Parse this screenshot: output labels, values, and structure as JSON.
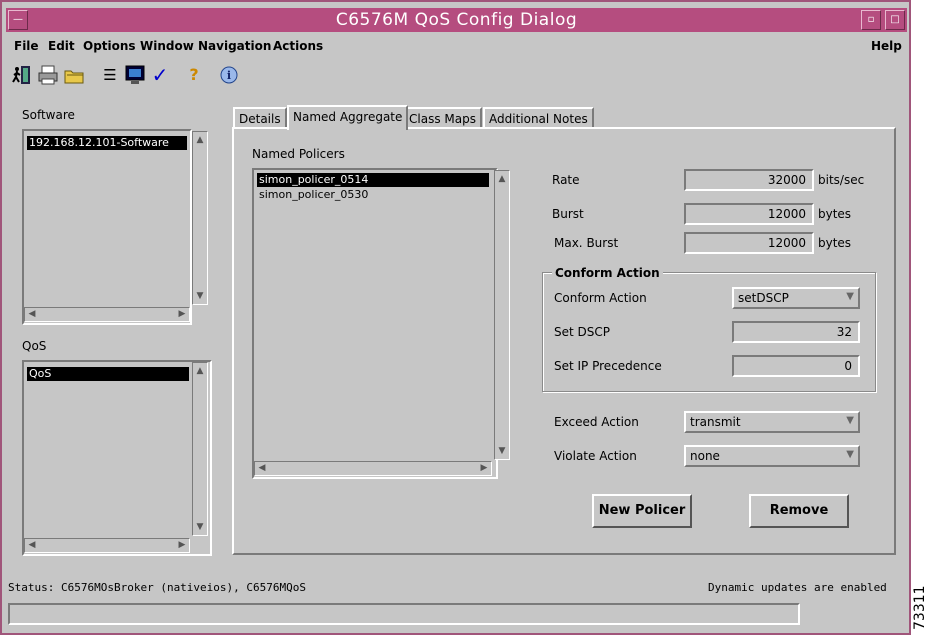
{
  "window": {
    "title": "C6576M QoS Config Dialog",
    "title_color": "#b54d7f",
    "window_menu_glyph": "—",
    "minimize_glyph": "▫",
    "maximize_glyph": "□"
  },
  "menubar": {
    "items": [
      {
        "label": "File"
      },
      {
        "label": "Edit"
      },
      {
        "label": "Options"
      },
      {
        "label": "Window"
      },
      {
        "label": "Navigation"
      },
      {
        "label": "Actions"
      }
    ],
    "help": "Help"
  },
  "toolbar": {
    "icons": [
      "exit-icon",
      "print-icon",
      "open-folder-icon",
      "list-icon",
      "monitor-icon",
      "checkmark-icon",
      "help-icon",
      "info-icon"
    ],
    "glyphs": {
      "list": "☰",
      "check": "✓",
      "help": "?",
      "info": "i"
    }
  },
  "left": {
    "software_label": "Software",
    "software_items": [
      "192.168.12.101-Software"
    ],
    "qos_label": "QoS",
    "qos_items": [
      "QoS"
    ]
  },
  "scroll": {
    "up": "▲",
    "down": "▼",
    "left": "◀",
    "right": "▶"
  },
  "tabs": [
    {
      "label": "Details",
      "active": false
    },
    {
      "label": "Named Aggregate",
      "active": true
    },
    {
      "label": "Class Maps",
      "active": false
    },
    {
      "label": "Additional Notes",
      "active": false
    }
  ],
  "named_policers": {
    "label": "Named Policers",
    "items": [
      "simon_policer_0514",
      "simon_policer_0530"
    ],
    "selected_index": 0
  },
  "form": {
    "rate_label": "Rate",
    "rate_value": "32000",
    "rate_unit": "bits/sec",
    "burst_label": "Burst",
    "burst_value": "12000",
    "burst_unit": "bytes",
    "max_burst_label": "Max. Burst",
    "max_burst_value": "12000",
    "max_burst_unit": "bytes"
  },
  "conform": {
    "group_title": "Conform Action",
    "action_label": "Conform Action",
    "action_value": "setDSCP",
    "dscp_label": "Set DSCP",
    "dscp_value": "32",
    "ipprec_label": "Set IP Precedence",
    "ipprec_value": "0"
  },
  "exceed": {
    "label": "Exceed Action",
    "value": "transmit"
  },
  "violate": {
    "label": "Violate Action",
    "value": "none"
  },
  "combo_arrow": "▼",
  "buttons": {
    "new_policer": "New Policer",
    "remove": "Remove"
  },
  "statusbar": {
    "status": "Status: C6576MOsBroker (nativeios), C6576MQoS",
    "updates": "Dynamic updates are enabled"
  },
  "figure_id": "73311"
}
